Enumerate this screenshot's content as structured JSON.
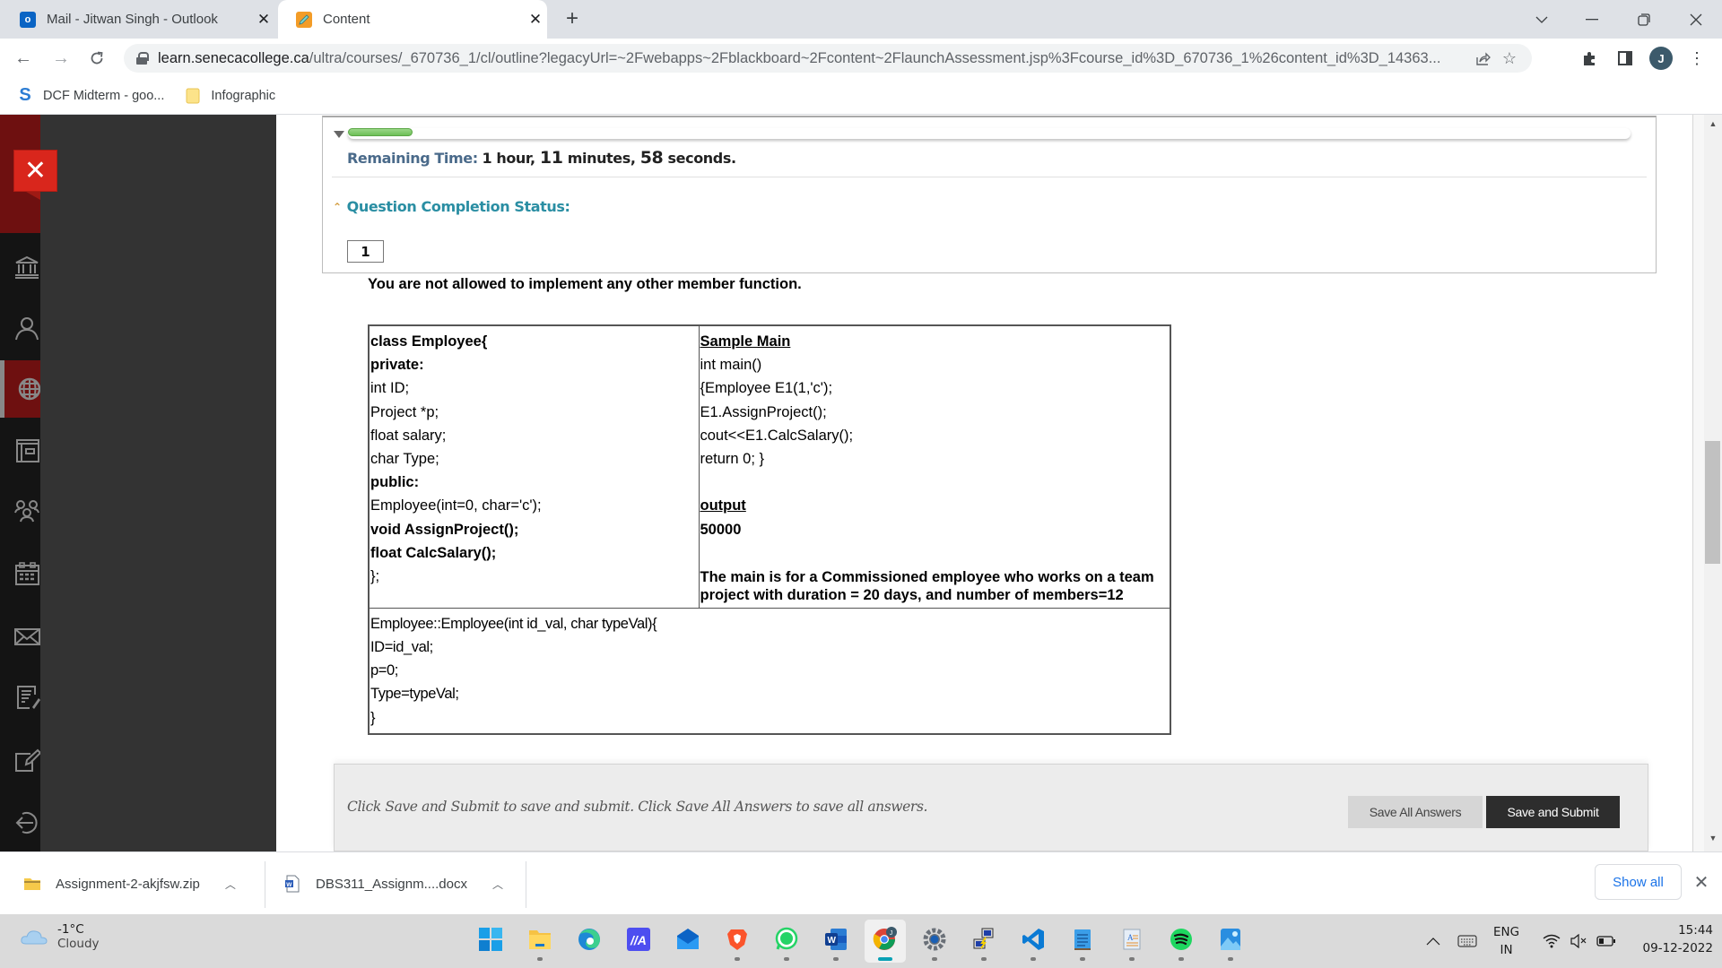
{
  "browser": {
    "tabs": [
      {
        "title": "Mail - Jitwan Singh - Outlook",
        "icon": "outlook-icon",
        "active": false
      },
      {
        "title": "Content",
        "icon": "pencil-icon",
        "active": true
      }
    ],
    "new_tab_label": "+",
    "url_host": "learn.senecacollege.ca",
    "url_path": "/ultra/courses/_670736_1/cl/outline?legacyUrl=~2Fwebapps~2Fblackboard~2Fcontent~2FlaunchAssessment.jsp%3Fcourse_id%3D_670736_1%26content_id%3D_14363...",
    "profile_initial": "J",
    "bookmarks": [
      {
        "label": "DCF Midterm - goo...",
        "icon": "sway-s-icon"
      },
      {
        "label": "Infographic",
        "icon": "folder-icon"
      }
    ]
  },
  "lms_nav": {
    "close_label": "✕",
    "items": [
      {
        "name": "institution",
        "icon": "institution-icon",
        "active": false
      },
      {
        "name": "profile",
        "icon": "person-icon",
        "active": false
      },
      {
        "name": "activity",
        "icon": "globe-icon",
        "active": true
      },
      {
        "name": "courses",
        "icon": "courses-icon",
        "active": false
      },
      {
        "name": "organizations",
        "icon": "group-icon",
        "active": false
      },
      {
        "name": "calendar",
        "icon": "calendar-icon",
        "active": false
      },
      {
        "name": "messages",
        "icon": "mail-icon",
        "active": false
      },
      {
        "name": "grades",
        "icon": "grades-icon",
        "active": false
      },
      {
        "name": "tools",
        "icon": "edit-icon",
        "active": false
      },
      {
        "name": "sign-out",
        "icon": "sign-out-icon",
        "active": false
      }
    ]
  },
  "assessment": {
    "timer_progress_fraction": 0.05,
    "remaining_label": "Remaining Time:",
    "remaining_parts": {
      "hours": "1",
      "hours_unit": " hour, ",
      "minutes": "11",
      "minutes_unit": " minutes, ",
      "seconds": "58",
      "seconds_unit": " seconds."
    },
    "completion_status_label": "Question Completion Status:",
    "questions": [
      "1"
    ],
    "instruction": "You are not allowed to implement any other member function.",
    "class_decl": [
      {
        "text": "class Employee{",
        "bold": true
      },
      {
        "text": "private:",
        "bold": true
      },
      {
        "text": "int ID;",
        "bold": false
      },
      {
        "text": "Project *p;",
        "bold": false
      },
      {
        "text": "float salary;",
        "bold": false
      },
      {
        "text": "char Type;",
        "bold": false
      },
      {
        "text": "public:",
        "bold": true
      },
      {
        "text": "Employee(int=0, char='c');",
        "bold": false
      },
      {
        "text": "void AssignProject();",
        "bold": true
      },
      {
        "text": "float CalcSalary();",
        "bold": true
      },
      {
        "text": "};",
        "bold": false
      }
    ],
    "sample_main_title": "Sample Main",
    "sample_main": [
      "int main()",
      "{Employee E1(1,'c');",
      "E1.AssignProject();",
      "cout<<E1.CalcSalary();",
      "return 0; }"
    ],
    "output_title": "output",
    "output_value": "50000",
    "note": "The main is for a Commissioned employee who works on a team project with duration = 20 days, and number of members=12",
    "constructor_impl": [
      "Employee::Employee(int id_val, char typeVal){",
      "ID=id_val;",
      "p=0;",
      "Type=typeVal;",
      "}"
    ],
    "footer_hint": "Click Save and Submit to save and submit. Click Save All Answers to save all answers.",
    "save_all_label": "Save All Answers",
    "save_submit_label": "Save and Submit"
  },
  "downloads": {
    "items": [
      {
        "filename": "Assignment-2-akjfsw.zip",
        "icon": "zip-folder-icon"
      },
      {
        "filename": "DBS311_Assignm....docx",
        "icon": "word-doc-icon"
      }
    ],
    "show_all_label": "Show all"
  },
  "taskbar": {
    "weather_temp": "-1°C",
    "weather_desc": "Cloudy",
    "apps": [
      {
        "name": "start",
        "icon": "windows-start-icon"
      },
      {
        "name": "file-explorer",
        "icon": "file-explorer-icon"
      },
      {
        "name": "edge",
        "icon": "edge-icon"
      },
      {
        "name": "app-ma",
        "icon": "ma-app-icon"
      },
      {
        "name": "mail",
        "icon": "mail-app-icon"
      },
      {
        "name": "brave",
        "icon": "brave-icon"
      },
      {
        "name": "whatsapp",
        "icon": "whatsapp-icon"
      },
      {
        "name": "word",
        "icon": "word-icon"
      },
      {
        "name": "chrome",
        "icon": "chrome-icon",
        "active": true
      },
      {
        "name": "settings",
        "icon": "settings-icon"
      },
      {
        "name": "putty",
        "icon": "putty-icon"
      },
      {
        "name": "vscode",
        "icon": "vscode-icon"
      },
      {
        "name": "notepad",
        "icon": "notepad-icon"
      },
      {
        "name": "wordpad",
        "icon": "wordpad-icon"
      },
      {
        "name": "spotify",
        "icon": "spotify-icon"
      },
      {
        "name": "photos",
        "icon": "photos-icon"
      }
    ],
    "lang_line1": "ENG",
    "lang_line2": "IN",
    "time": "15:44",
    "date": "09-12-2022"
  }
}
